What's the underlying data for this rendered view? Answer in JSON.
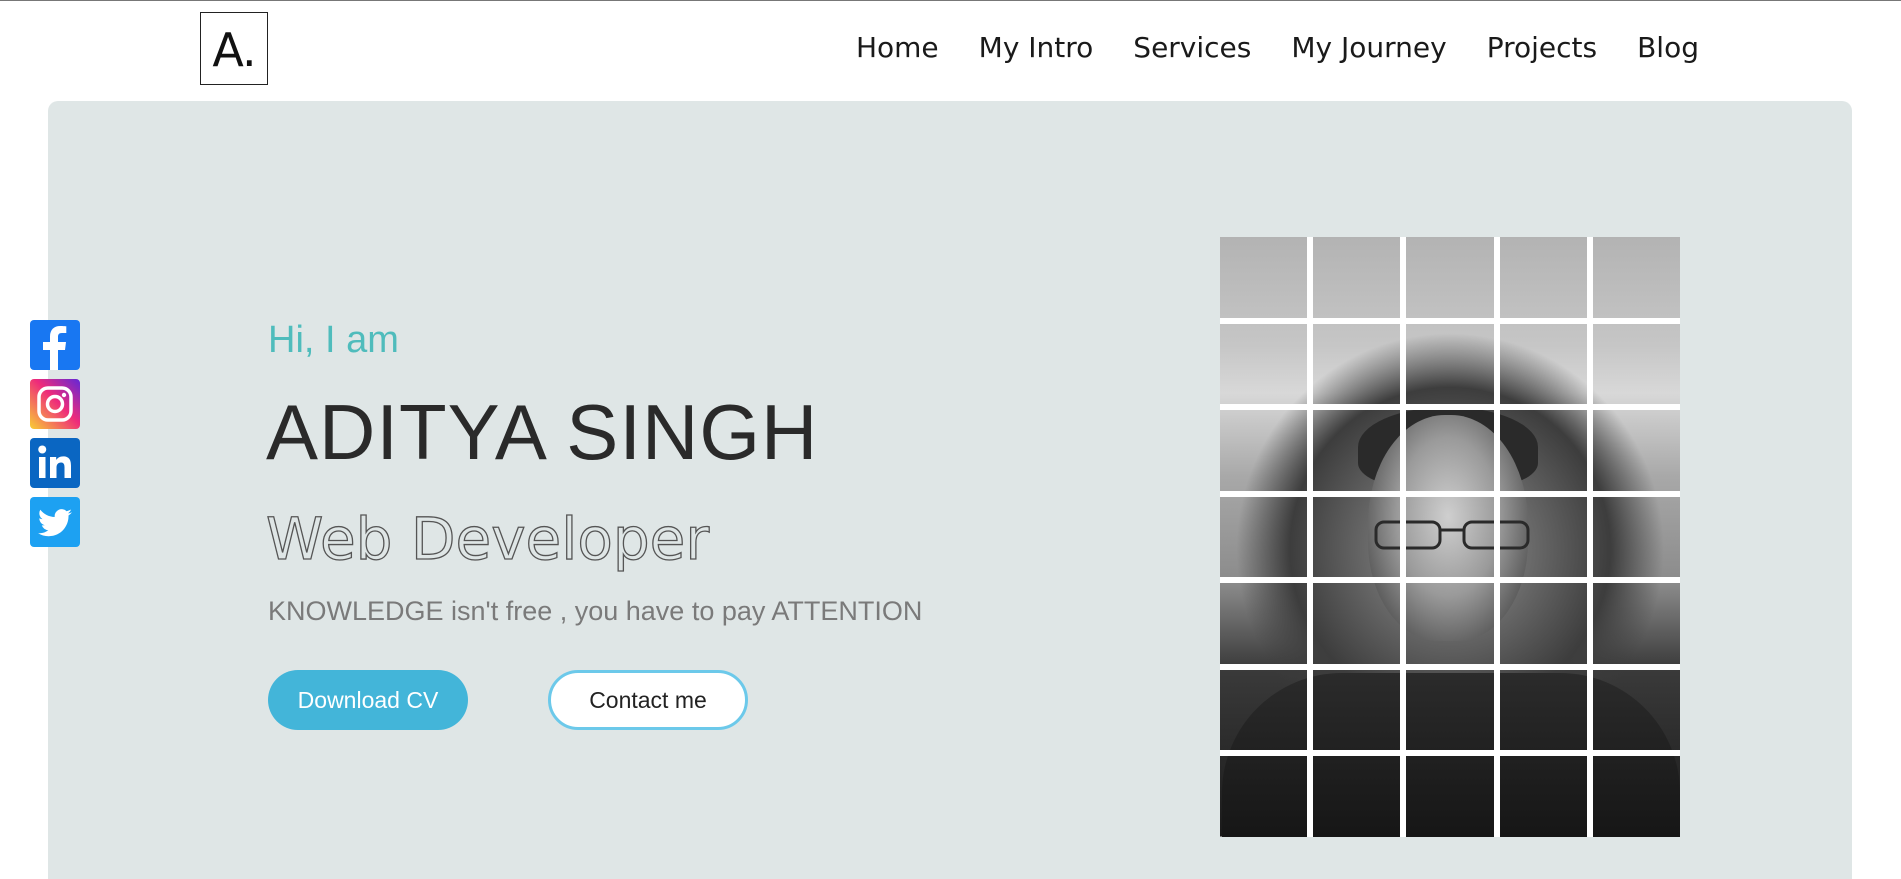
{
  "logo": {
    "text": "A."
  },
  "nav": {
    "items": [
      {
        "label": "Home"
      },
      {
        "label": "My Intro"
      },
      {
        "label": "Services"
      },
      {
        "label": "My Journey"
      },
      {
        "label": "Projects"
      },
      {
        "label": "Blog"
      }
    ]
  },
  "hero": {
    "greeting": "Hi, I am",
    "name": "ADITYA SINGH",
    "role": "Web Developer",
    "quote": "KNOWLEDGE isn't free , you have to pay ATTENTION",
    "download_label": "Download CV",
    "contact_label": "Contact me"
  },
  "social": [
    {
      "icon": "facebook-icon",
      "color": "#1877f2"
    },
    {
      "icon": "instagram-icon",
      "color": "#e1306c"
    },
    {
      "icon": "linkedin-icon",
      "color": "#0a66c2"
    },
    {
      "icon": "twitter-icon",
      "color": "#1da1f2"
    }
  ],
  "colors": {
    "hero_bg": "#dfe6e6",
    "accent": "#43b5d9",
    "greeting": "#4fbcbc"
  },
  "photo": {
    "grid_columns": 5,
    "grid_rows": 7,
    "style": "grayscale"
  }
}
